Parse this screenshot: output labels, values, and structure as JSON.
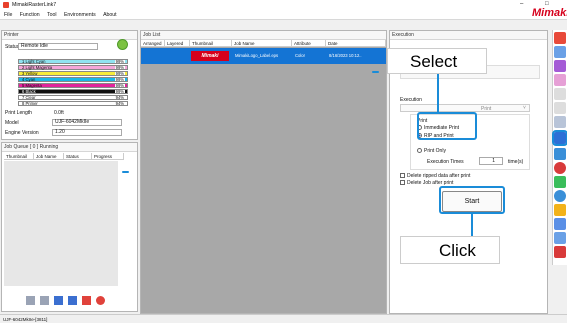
{
  "window": {
    "title": "MimakiRasterLink7",
    "minimize": "–",
    "maximize": "□",
    "brand": "Mimaki"
  },
  "menu": [
    "File",
    "Function",
    "Tool",
    "Environments",
    "About"
  ],
  "printer": {
    "title": "Printer",
    "status_label": "Status",
    "status_value": "Remote Idle",
    "inks": [
      {
        "name": "1 Light Cyan",
        "pct": "99%",
        "color": "#8fe3f0"
      },
      {
        "name": "2 Light Magenta",
        "pct": "99%",
        "color": "#f4a6d9"
      },
      {
        "name": "3 Yellow",
        "pct": "99%",
        "color": "#f7ec3b"
      },
      {
        "name": "4 Cyan",
        "pct": "99%",
        "color": "#19b7e6"
      },
      {
        "name": "5 Magenta",
        "pct": "99%",
        "color": "#e2249b"
      },
      {
        "name": "6 Black",
        "pct": "99%",
        "color": "#101010"
      },
      {
        "name": "7 Clear",
        "pct": "94%",
        "color": "#ffffff"
      },
      {
        "name": "8 Primer",
        "pct": "94%",
        "color": "#ffffff"
      }
    ],
    "print_length_label": "Print Length",
    "print_length_value": "0.0ft",
    "model_label": "Model",
    "model_value": "UJF-6042MkIIe",
    "engine_label": "Engine Version",
    "engine_value": "1.20"
  },
  "queue": {
    "title": "Job Queue [ 0 ] Running",
    "columns": [
      "Thumbnail",
      "Job Name",
      "Status",
      "Progress"
    ]
  },
  "joblist": {
    "title": "Job List",
    "columns": [
      "Arranged",
      "Layered",
      "Thumbnail",
      "Job Name",
      "Attribute",
      "Date"
    ],
    "row": {
      "thumb": "Mimaki",
      "name": "MimakiLogo_Label.eps",
      "attribute": "Color",
      "date": "8/16/2023 10:12.."
    }
  },
  "execution": {
    "title": "Execution",
    "group_label": "Execution",
    "select_value": "Print",
    "print_label": "Print",
    "immediate_print": "Immediate Print",
    "rip_and_print": "RIP and Print",
    "print_only": "Print Only",
    "times_label": "Execution Times",
    "times_value": "1",
    "times_unit": "time(s)",
    "delete_ripped": "Delete ripped data after print",
    "delete_job": "Delete Job after print",
    "start_button": "Start"
  },
  "callouts": {
    "select": "Select",
    "click": "Click"
  },
  "statusbar": "UJF-6042MkIIe-[3811]"
}
